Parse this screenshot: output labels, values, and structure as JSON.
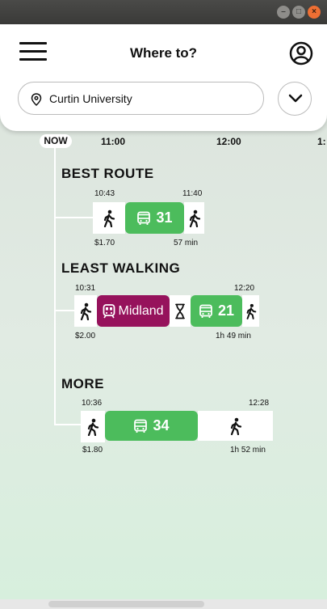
{
  "window": {
    "controls": [
      "–",
      "□",
      "×"
    ]
  },
  "header": {
    "title": "Where to?"
  },
  "search": {
    "value": "Curtin University"
  },
  "timeline": {
    "now": "NOW",
    "ticks": [
      "11:00",
      "12:00",
      "1:"
    ]
  },
  "routes": {
    "best": {
      "heading": "BEST ROUTE",
      "depart": "10:43",
      "arrive": "11:40",
      "bus": "31",
      "cost": "$1.70",
      "duration": "57 min"
    },
    "least_walking": {
      "heading": "LEAST WALKING",
      "depart": "10:31",
      "arrive": "12:20",
      "train": "Midland",
      "bus": "21",
      "cost": "$2.00",
      "duration": "1h 49 min"
    },
    "more": {
      "heading": "MORE",
      "depart": "10:36",
      "arrive": "12:28",
      "bus": "34",
      "cost": "$1.80",
      "duration": "1h 52 min"
    }
  }
}
